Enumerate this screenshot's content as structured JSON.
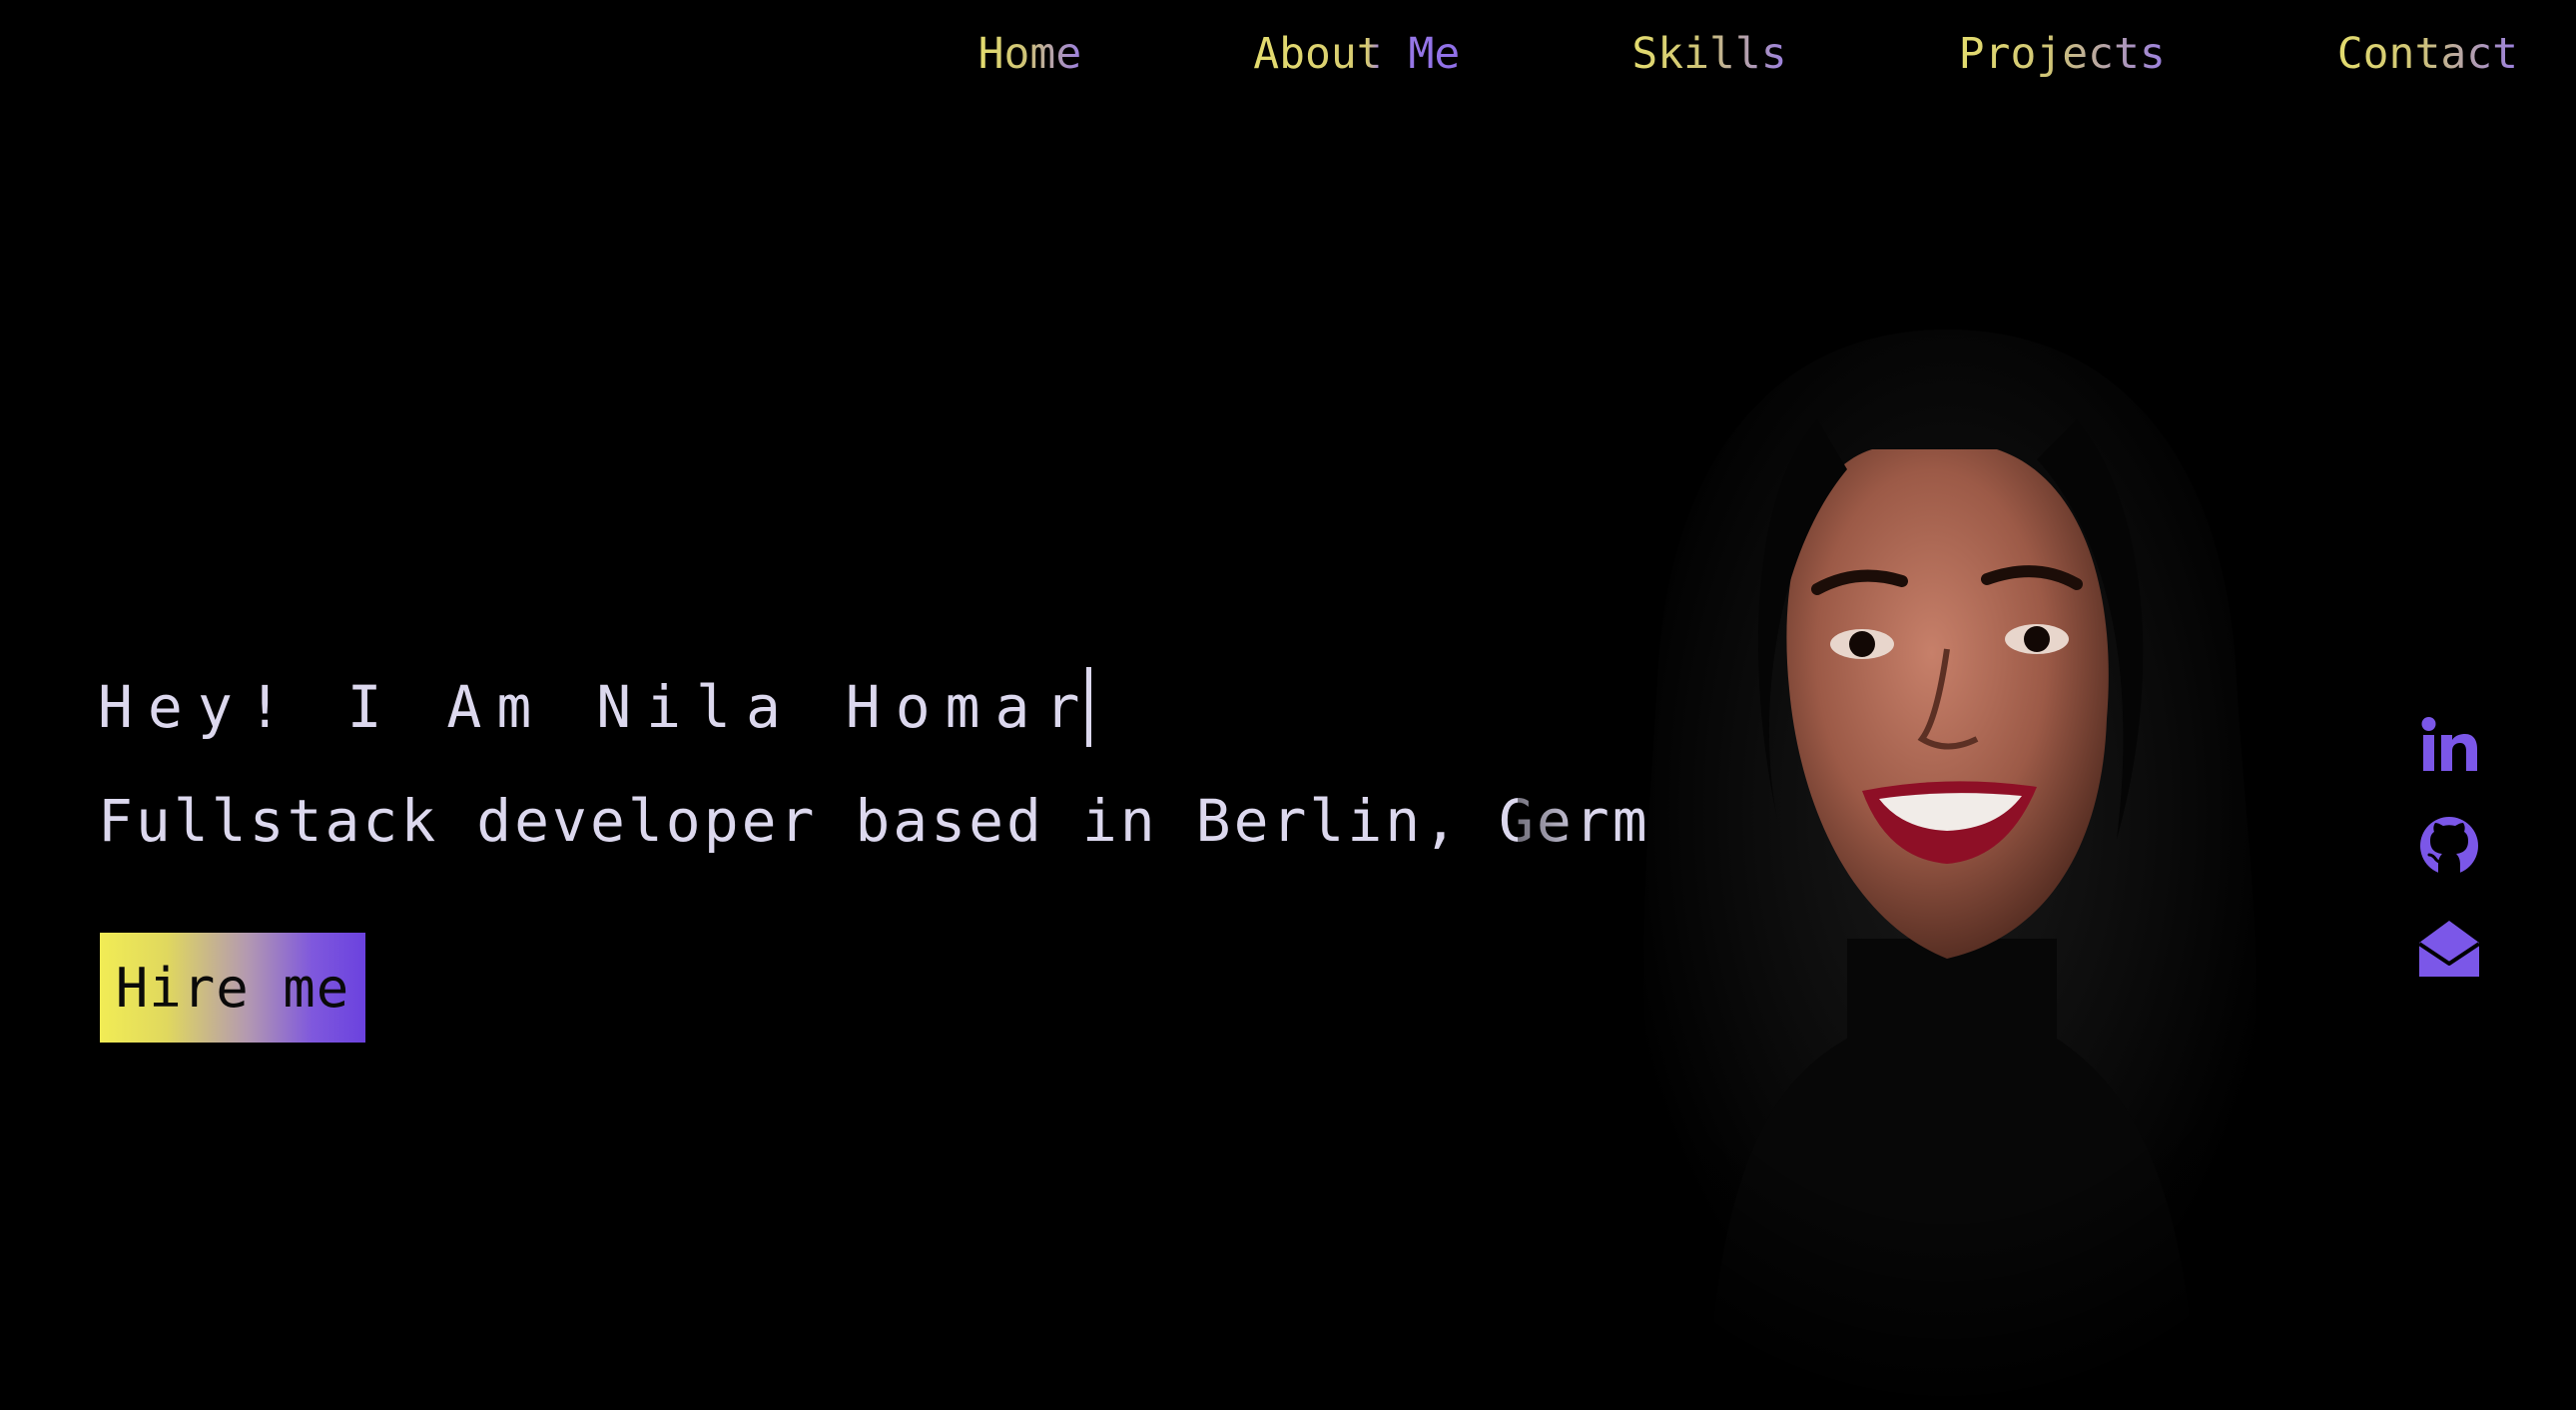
{
  "nav": {
    "items": [
      {
        "label": "Home"
      },
      {
        "label": "About Me"
      },
      {
        "label": "Skills"
      },
      {
        "label": "Projects"
      },
      {
        "label": "Contact"
      }
    ]
  },
  "hero": {
    "greeting": "Hey! I Am Nila Homar",
    "tagline": "Fullstack developer based in Berlin, Germany",
    "cta_label": "Hire me"
  },
  "social": {
    "icons": [
      "linkedin-icon",
      "github-icon",
      "email-icon"
    ]
  },
  "colors": {
    "background": "#000000",
    "text": "#dcd8ee",
    "accent_yellow": "#f1ec55",
    "accent_purple": "#7b57e8"
  }
}
